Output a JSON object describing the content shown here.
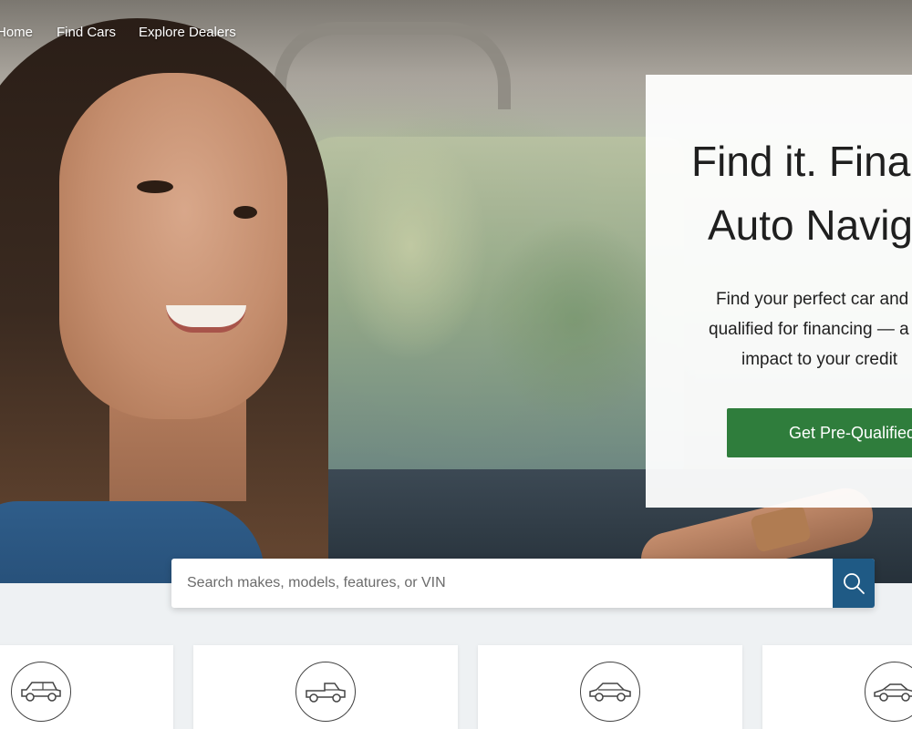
{
  "nav": {
    "items": [
      {
        "label": "Home"
      },
      {
        "label": "Find Cars"
      },
      {
        "label": "Explore Dealers"
      }
    ]
  },
  "hero": {
    "title_line1": "Find it. Finar",
    "title_line2": "Auto Navig",
    "text_line1": "Find your perfect car and",
    "text_line2": "qualified for financing — a",
    "text_line3": "impact to your credit",
    "cta_label": "Get Pre-Qualified",
    "cta_color": "#2f7d3c"
  },
  "search": {
    "placeholder": "Search makes, models, features, or VIN",
    "button_icon": "search-icon",
    "button_color": "#1f5a85"
  },
  "categories": [
    {
      "icon": "suv-icon"
    },
    {
      "icon": "truck-icon"
    },
    {
      "icon": "sedan-icon"
    },
    {
      "icon": "coupe-icon"
    }
  ]
}
